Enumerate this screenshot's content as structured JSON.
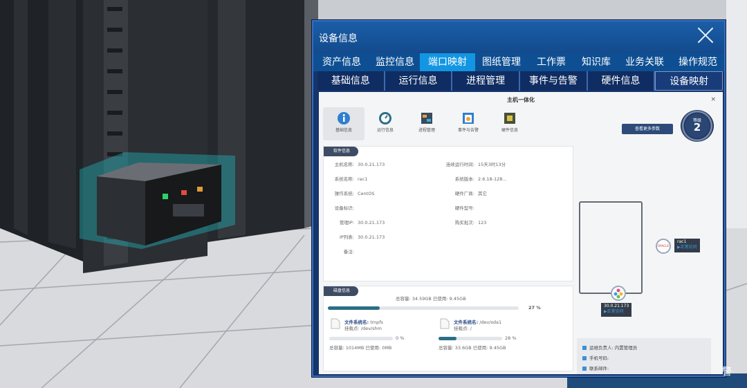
{
  "dialog": {
    "title": "设备信息",
    "tabs_top": [
      {
        "label": "资产信息"
      },
      {
        "label": "监控信息"
      },
      {
        "label": "端口映射"
      },
      {
        "label": "图纸管理"
      },
      {
        "label": "工作票"
      },
      {
        "label": "知识库"
      },
      {
        "label": "业务关联"
      },
      {
        "label": "操作规范"
      }
    ],
    "tabs_top_active": 2,
    "tabs_sub": [
      {
        "label": "基础信息"
      },
      {
        "label": "运行信息"
      },
      {
        "label": "进程管理"
      },
      {
        "label": "事件与告警"
      },
      {
        "label": "硬件信息"
      },
      {
        "label": "设备映射"
      }
    ],
    "tabs_sub_active": 5
  },
  "content": {
    "title": "主机一体化",
    "close": "×",
    "icons": [
      {
        "label": "基础信息",
        "icon": "info-icon"
      },
      {
        "label": "运行信息",
        "icon": "gauge-icon"
      },
      {
        "label": "进程管理",
        "icon": "process-icon"
      },
      {
        "label": "事件与告警",
        "icon": "alarm-icon"
      },
      {
        "label": "硬件信息",
        "icon": "chip-icon"
      }
    ],
    "more_button": "查看更多参数",
    "level": {
      "label": "等级",
      "value": "2"
    }
  },
  "software": {
    "header": "软件信息",
    "left": [
      {
        "key": "主机名称:",
        "value": "30.0.21.173"
      },
      {
        "key": "系统名称:",
        "value": "rac1"
      },
      {
        "key": "操作系统:",
        "value": "CentOS"
      },
      {
        "key": "设备标识:",
        "value": ""
      },
      {
        "key": "管理IP:",
        "value": "30.0.21.173"
      },
      {
        "key": "IP列表:",
        "value": "30.0.21.173"
      },
      {
        "key": "备注:",
        "value": ""
      }
    ],
    "right": [
      {
        "key": "连续运行时间:",
        "value": "15天3时13分"
      },
      {
        "key": "系统版本:",
        "value": "2.6.18-128..."
      },
      {
        "key": "硬件厂商:",
        "value": "其它"
      },
      {
        "key": "硬件型号:",
        "value": ""
      },
      {
        "key": "购买批次:",
        "value": "123"
      }
    ]
  },
  "disk": {
    "header": "磁盘信息",
    "summary": "总容量: 34.59GB 已使用: 9.45GB",
    "percent_label": "27 %",
    "percent": 27,
    "filesystems": [
      {
        "name_key": "文件系统名:",
        "name": "tmpfs",
        "mount": "挂载点: /dev/shm",
        "percent_label": "0 %",
        "percent": 0,
        "total": "总容量: 1014MB 已使用: 0MB"
      },
      {
        "name_key": "文件系统名:",
        "name": "/dev/sda1",
        "mount": "挂载点: /",
        "percent_label": "28 %",
        "percent": 28,
        "total": "总容量: 33.6GB 已使用: 9.45GB"
      }
    ]
  },
  "topology": {
    "db_node": {
      "name": "rac1",
      "status": "▶正常访问",
      "logo": "ORACLE"
    },
    "host_node": {
      "name": "30.0.21.173",
      "status": "▶正常访问"
    }
  },
  "contact": {
    "owner": "运维负责人: 内置管理员",
    "phone": "手机号码:",
    "email": "联系邮件:"
  },
  "corner_text": "警",
  "colors": {
    "active_tab": "#1296e3",
    "header_blue": "#15356b",
    "bar": "#2a6e86"
  }
}
